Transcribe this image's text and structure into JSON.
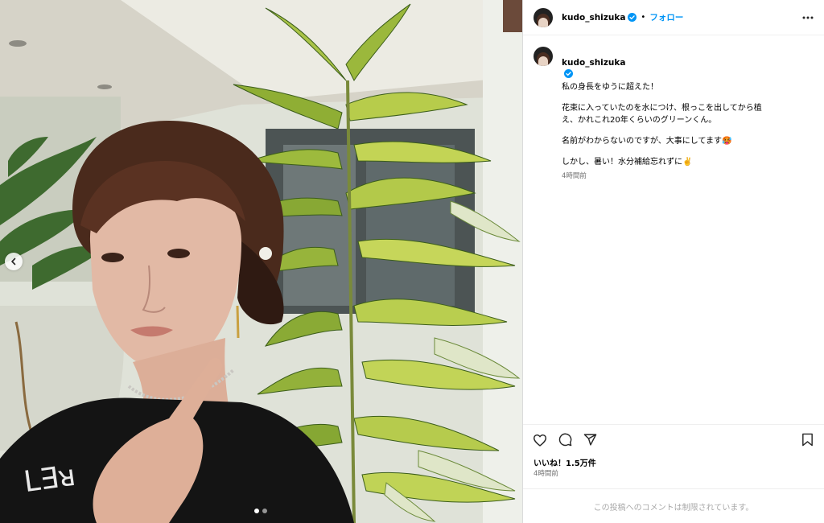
{
  "photo": {
    "description_icon": "photo"
  },
  "carousel": {
    "prev_icon": "chevron-left-icon",
    "slides": 2,
    "active": 1
  },
  "header": {
    "username": "kudo_shizuka",
    "separator": "•",
    "follow_label": "フォロー",
    "more_icon": "more-horizontal-icon"
  },
  "caption": {
    "username": "kudo_shizuka",
    "line1": "私の身長をゆうに超えた！",
    "para2": "花束に入っていたのを水につけ、根っこを出してから植え、かれこれ20年くらいのグリーンくん。",
    "para3": "名前がわからないのですが、大事にしてます🥵",
    "para4": "しかし、暑い！水分補給忘れずに✌️",
    "time": "4時間前"
  },
  "actions": {
    "like_icon": "heart-icon",
    "comment_icon": "comment-icon",
    "share_icon": "send-icon",
    "save_icon": "bookmark-icon"
  },
  "likes": "いいね！1.5万件",
  "posted_time": "4時間前",
  "comments_disabled": "この投稿へのコメントは制限されています。",
  "colors": {
    "accent": "#0095f6",
    "verified": "#0095f6",
    "muted": "#737373"
  }
}
